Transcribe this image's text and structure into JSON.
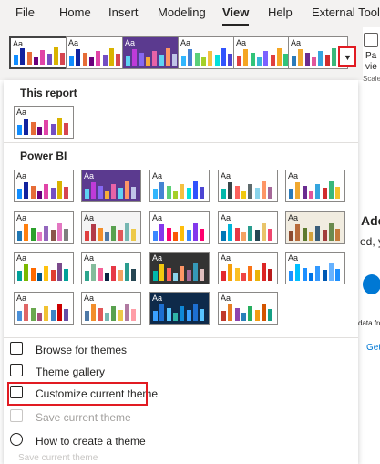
{
  "menubar": {
    "tabs": [
      {
        "label": "File",
        "active": false
      },
      {
        "label": "Home",
        "active": false
      },
      {
        "label": "Insert",
        "active": false
      },
      {
        "label": "Modeling",
        "active": false
      },
      {
        "label": "View",
        "active": true
      },
      {
        "label": "Help",
        "active": false
      },
      {
        "label": "External Tools",
        "active": false
      }
    ]
  },
  "ribbon_right": {
    "page_view_label_1": "Pa",
    "page_view_label_2": "vie",
    "scale_label": "Scale",
    "add_heading": "Adc",
    "added_text": "ed, yo",
    "data_from": "data from",
    "get_text": "Get"
  },
  "theme_tile_text": "Aa",
  "theme_strip": {
    "expand_icon": "chevron-down-icon"
  },
  "gallery": {
    "this_report_title": "This report",
    "power_bi_title": "Power BI"
  },
  "themes": {
    "strip": [
      {
        "bg": "#ffffff",
        "text": "#252423",
        "bars": [
          "#118dff",
          "#12239e",
          "#e66c37",
          "#6b007b",
          "#e044a7",
          "#744ec2",
          "#d9b300",
          "#d64550"
        ]
      },
      {
        "bg": "#ffffff",
        "text": "#252423",
        "bars": [
          "#118dff",
          "#12239e",
          "#e66c37",
          "#6b007b",
          "#e044a7",
          "#744ec2",
          "#d9b300",
          "#d64550"
        ]
      },
      {
        "bg": "#5b3a8f",
        "text": "#ffffff",
        "bars": [
          "#5fd3f3",
          "#bf3bd8",
          "#8668f2",
          "#f6ad3a",
          "#e863a7",
          "#5fd3f3",
          "#fe9666",
          "#c0c4e8"
        ]
      },
      {
        "bg": "#ffffff",
        "text": "#252423",
        "bars": [
          "#31b6fd",
          "#4584d3",
          "#5bd078",
          "#a5d028",
          "#f5c040",
          "#05e0db",
          "#3153fd",
          "#4c45d3"
        ]
      },
      {
        "bg": "#ffffff",
        "text": "#252423",
        "bars": [
          "#e03f3f",
          "#f5a623",
          "#31c47a",
          "#38b6d8",
          "#7b61ff",
          "#e03f3f",
          "#f5a623",
          "#31c47a"
        ]
      },
      {
        "bg": "#ffffff",
        "text": "#252423",
        "bars": [
          "#2a7ab9",
          "#f0a830",
          "#6a2c91",
          "#e0569b",
          "#35a5de",
          "#d12d2d",
          "#39b77b",
          "#f4c12d"
        ]
      }
    ],
    "this_report": [
      {
        "bg": "#ffffff",
        "text": "#252423",
        "bars": [
          "#118dff",
          "#12239e",
          "#e66c37",
          "#6b007b",
          "#e044a7",
          "#744ec2",
          "#d9b300",
          "#d64550"
        ]
      }
    ],
    "power_bi": [
      {
        "bg": "#ffffff",
        "text": "#252423",
        "bars": [
          "#118dff",
          "#12239e",
          "#e66c37",
          "#6b007b",
          "#e044a7",
          "#744ec2",
          "#d9b300",
          "#d64550"
        ]
      },
      {
        "bg": "#5b3a8f",
        "text": "#ffffff",
        "bars": [
          "#5fd3f3",
          "#bf3bd8",
          "#8668f2",
          "#f6ad3a",
          "#e863a7",
          "#5fd3f3",
          "#fe9666",
          "#c0c4e8"
        ]
      },
      {
        "bg": "#ffffff",
        "text": "#252423",
        "bars": [
          "#31b6fd",
          "#4584d3",
          "#5bd078",
          "#a5d028",
          "#f5c040",
          "#05e0db",
          "#3153fd",
          "#4c45d3"
        ]
      },
      {
        "bg": "#ffffff",
        "text": "#252423",
        "bars": [
          "#01b8aa",
          "#374649",
          "#fd625e",
          "#f2c80f",
          "#5f6b6d",
          "#8ad4eb",
          "#fe9666",
          "#a66999"
        ]
      },
      {
        "bg": "#ffffff",
        "text": "#252423",
        "bars": [
          "#2a7ab9",
          "#f0a830",
          "#6a2c91",
          "#e0569b",
          "#35a5de",
          "#d12d2d",
          "#39b77b",
          "#f4c12d"
        ]
      },
      {
        "bg": "#ffffff",
        "text": "#252423",
        "bars": [
          "#1f77b4",
          "#ff7f0e",
          "#2ca02c",
          "#e377c2",
          "#9467bd",
          "#8c564b",
          "#e377c2",
          "#7f7f7f"
        ]
      },
      {
        "bg": "#f4f4f4",
        "text": "#252423",
        "bars": [
          "#e03f3f",
          "#b23a48",
          "#f28e2b",
          "#4e79a7",
          "#59a14f",
          "#e15759",
          "#76b7b2",
          "#edc948"
        ]
      },
      {
        "bg": "#ffffff",
        "text": "#252423",
        "bars": [
          "#3a86ff",
          "#8338ec",
          "#ff006e",
          "#fb5607",
          "#ffbe0b",
          "#3a86ff",
          "#8338ec",
          "#ff006e"
        ]
      },
      {
        "bg": "#ffffff",
        "text": "#252423",
        "bars": [
          "#0077b6",
          "#00b4d8",
          "#e63946",
          "#f4a261",
          "#2a9d8f",
          "#264653",
          "#e9c46a",
          "#ef476f"
        ]
      },
      {
        "bg": "#f1ece0",
        "text": "#252423",
        "bars": [
          "#8c4b2f",
          "#b86b3a",
          "#5c7a2e",
          "#d4a23c",
          "#3b5e7a",
          "#a23c3c",
          "#6a8a4e",
          "#c47a3a"
        ]
      },
      {
        "bg": "#ffffff",
        "text": "#252423",
        "bars": [
          "#00a19a",
          "#7ab800",
          "#ff6900",
          "#00558c",
          "#ffc20e",
          "#e03c31",
          "#7b4a8c",
          "#00a19a"
        ]
      },
      {
        "bg": "#ffffff",
        "text": "#252423",
        "bars": [
          "#2ca58d",
          "#84bc9c",
          "#f46197",
          "#0a2342",
          "#e63946",
          "#f4a261",
          "#2a9d8f",
          "#264653"
        ]
      },
      {
        "bg": "#333333",
        "text": "#ffffff",
        "bars": [
          "#01b8aa",
          "#f2c80f",
          "#fd625e",
          "#8ad4eb",
          "#fe9666",
          "#a66999",
          "#3599b8",
          "#dfbfbf"
        ]
      },
      {
        "bg": "#ffffff",
        "text": "#252423",
        "bars": [
          "#e3292d",
          "#f59e0b",
          "#fbbf24",
          "#ef4444",
          "#f97316",
          "#eab308",
          "#dc2626",
          "#b91c1c"
        ]
      },
      {
        "bg": "#ffffff",
        "text": "#252423",
        "bars": [
          "#1e90ff",
          "#00bfff",
          "#1e90ff",
          "#0073e6",
          "#3399ff",
          "#0059b3",
          "#66b2ff",
          "#1e90ff"
        ]
      },
      {
        "bg": "#ffffff",
        "text": "#252423",
        "bars": [
          "#4a90d9",
          "#e06666",
          "#6aa84f",
          "#a64d79",
          "#f1c232",
          "#3d85c6",
          "#cc0000",
          "#674ea7"
        ]
      },
      {
        "bg": "#ffffff",
        "text": "#252423",
        "bars": [
          "#4e79a7",
          "#f28e2b",
          "#e15759",
          "#76b7b2",
          "#59a14f",
          "#edc948",
          "#b07aa1",
          "#ff9da7"
        ]
      },
      {
        "bg": "#0e2a4a",
        "text": "#ffffff",
        "bars": [
          "#3aa0ff",
          "#1d6fd1",
          "#58c4ff",
          "#2fb5a8",
          "#0f88d6",
          "#3aa0ff",
          "#1d6fd1",
          "#58c4ff"
        ]
      },
      {
        "bg": "#ffffff",
        "text": "#252423",
        "bars": [
          "#c0392b",
          "#e67e22",
          "#8e44ad",
          "#2980b9",
          "#27ae60",
          "#f39c12",
          "#d35400",
          "#16a085"
        ]
      }
    ]
  },
  "menu": {
    "items": [
      {
        "label": "Browse for themes",
        "icon": "folder-open-icon",
        "disabled": false
      },
      {
        "label": "Theme gallery",
        "icon": "theme-gallery-icon",
        "disabled": false
      },
      {
        "label": "Customize current theme",
        "icon": "edit-pencil-icon",
        "disabled": false
      },
      {
        "label": "Save current theme",
        "icon": "save-icon",
        "disabled": true
      },
      {
        "label": "How to create a theme",
        "icon": "help-circle-icon",
        "disabled": false
      }
    ],
    "ghost_label": "Save current theme"
  },
  "colors": {
    "highlight": "#e11b22",
    "ribbon_bg": "#f3f2f1"
  }
}
